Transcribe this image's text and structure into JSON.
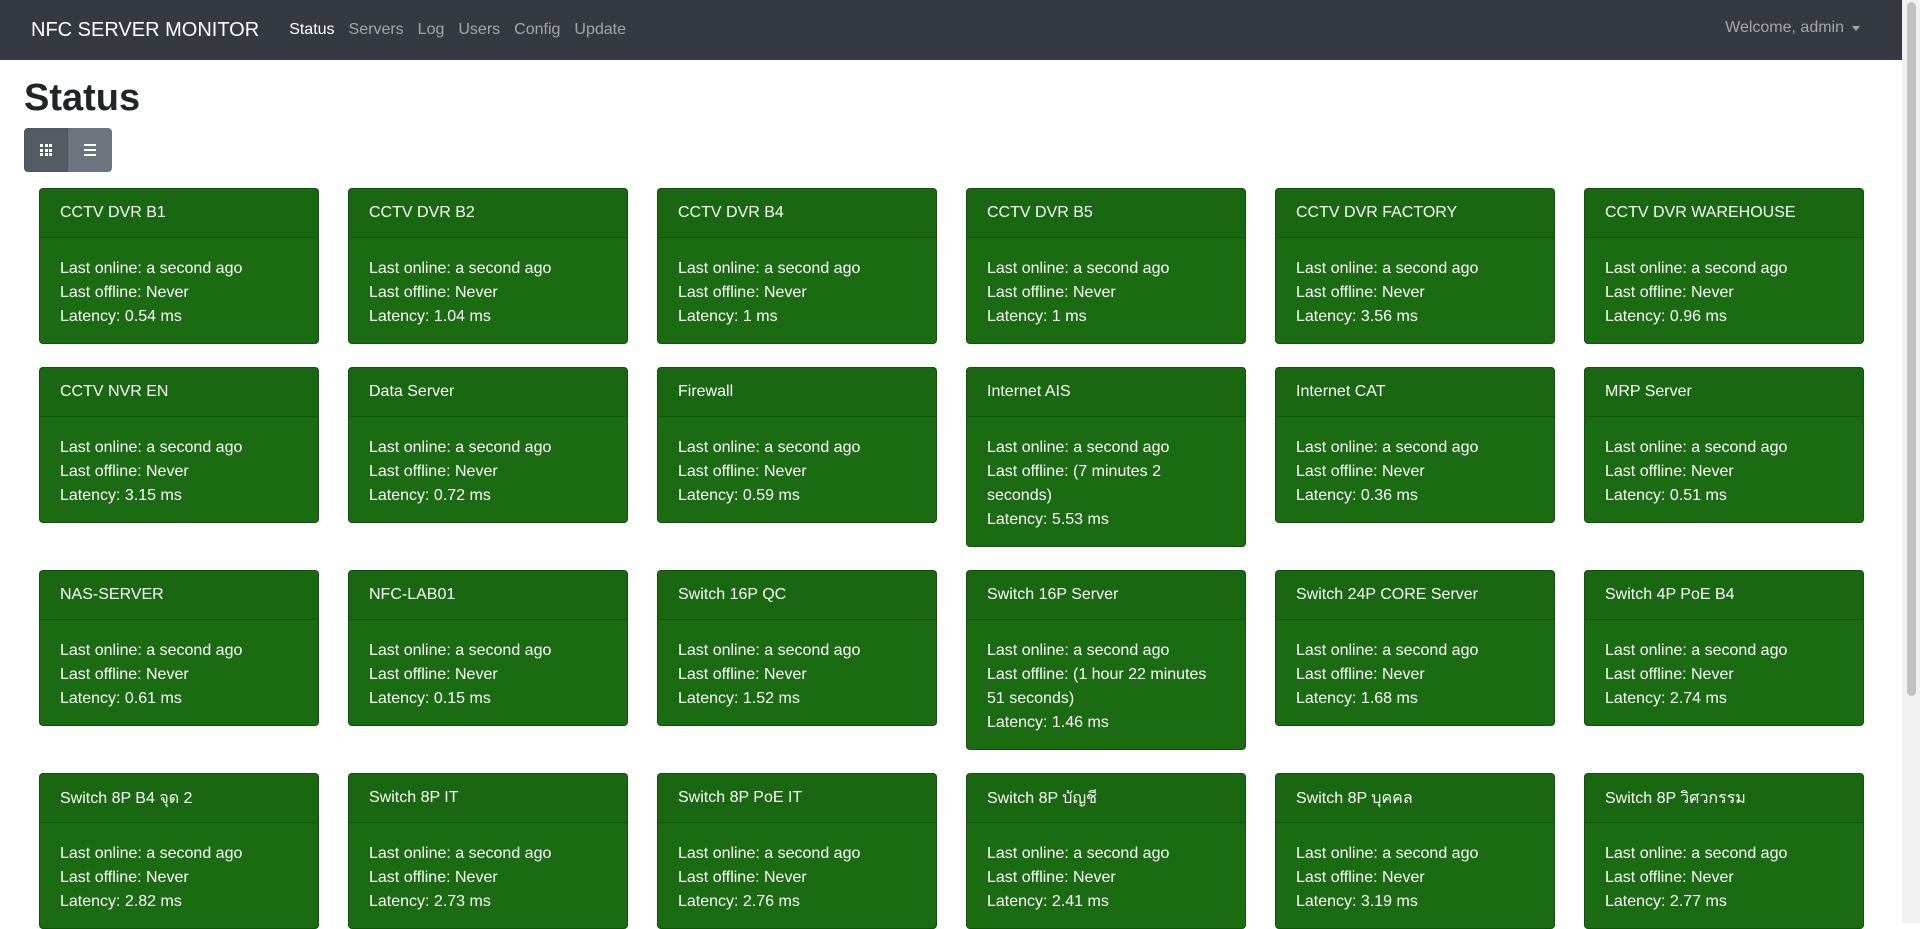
{
  "navbar": {
    "brand": "NFC SERVER MONITOR",
    "links": [
      "Status",
      "Servers",
      "Log",
      "Users",
      "Config",
      "Update"
    ],
    "user": "Welcome, admin"
  },
  "page": {
    "title": "Status"
  },
  "view_toggle": {
    "active": "grid"
  },
  "colors": {
    "online_card": "#1a6b12",
    "navbar": "#343a40"
  },
  "servers": [
    {
      "name": "CCTV DVR B1",
      "last_online": "Last online: a second ago",
      "last_offline": "Last offline: Never",
      "latency": "Latency: 0.54 ms"
    },
    {
      "name": "CCTV DVR B2",
      "last_online": "Last online: a second ago",
      "last_offline": "Last offline: Never",
      "latency": "Latency: 1.04 ms"
    },
    {
      "name": "CCTV DVR B4",
      "last_online": "Last online: a second ago",
      "last_offline": "Last offline: Never",
      "latency": "Latency: 1 ms"
    },
    {
      "name": "CCTV DVR B5",
      "last_online": "Last online: a second ago",
      "last_offline": "Last offline: Never",
      "latency": "Latency: 1 ms"
    },
    {
      "name": "CCTV DVR FACTORY",
      "last_online": "Last online: a second ago",
      "last_offline": "Last offline: Never",
      "latency": "Latency: 3.56 ms"
    },
    {
      "name": "CCTV DVR WAREHOUSE",
      "last_online": "Last online: a second ago",
      "last_offline": "Last offline: Never",
      "latency": "Latency: 0.96 ms"
    },
    {
      "name": "CCTV NVR EN",
      "last_online": "Last online: a second ago",
      "last_offline": "Last offline: Never",
      "latency": "Latency: 3.15 ms"
    },
    {
      "name": "Data Server",
      "last_online": "Last online: a second ago",
      "last_offline": "Last offline: Never",
      "latency": "Latency: 0.72 ms"
    },
    {
      "name": "Firewall",
      "last_online": "Last online: a second ago",
      "last_offline": "Last offline: Never",
      "latency": "Latency: 0.59 ms"
    },
    {
      "name": "Internet AIS",
      "last_online": "Last online: a second ago",
      "last_offline": "Last offline: (7 minutes 2 seconds)",
      "latency": "Latency: 5.53 ms"
    },
    {
      "name": "Internet CAT",
      "last_online": "Last online: a second ago",
      "last_offline": "Last offline: Never",
      "latency": "Latency: 0.36 ms"
    },
    {
      "name": "MRP Server",
      "last_online": "Last online: a second ago",
      "last_offline": "Last offline: Never",
      "latency": "Latency: 0.51 ms"
    },
    {
      "name": "NAS-SERVER",
      "last_online": "Last online: a second ago",
      "last_offline": "Last offline: Never",
      "latency": "Latency: 0.61 ms"
    },
    {
      "name": "NFC-LAB01",
      "last_online": "Last online: a second ago",
      "last_offline": "Last offline: Never",
      "latency": "Latency: 0.15 ms"
    },
    {
      "name": "Switch 16P QC",
      "last_online": "Last online: a second ago",
      "last_offline": "Last offline: Never",
      "latency": "Latency: 1.52 ms"
    },
    {
      "name": "Switch 16P Server",
      "last_online": "Last online: a second ago",
      "last_offline": "Last offline: (1 hour 22 minutes 51 seconds)",
      "latency": "Latency: 1.46 ms"
    },
    {
      "name": "Switch 24P CORE Server",
      "last_online": "Last online: a second ago",
      "last_offline": "Last offline: Never",
      "latency": "Latency: 1.68 ms"
    },
    {
      "name": "Switch 4P PoE B4",
      "last_online": "Last online: a second ago",
      "last_offline": "Last offline: Never",
      "latency": "Latency: 2.74 ms"
    },
    {
      "name": "Switch 8P B4 จุด 2",
      "last_online": "Last online: a second ago",
      "last_offline": "Last offline: Never",
      "latency": "Latency: 2.82 ms"
    },
    {
      "name": "Switch 8P IT",
      "last_online": "Last online: a second ago",
      "last_offline": "Last offline: Never",
      "latency": "Latency: 2.73 ms"
    },
    {
      "name": "Switch 8P PoE IT",
      "last_online": "Last online: a second ago",
      "last_offline": "Last offline: Never",
      "latency": "Latency: 2.76 ms"
    },
    {
      "name": "Switch 8P บัญชี",
      "last_online": "Last online: a second ago",
      "last_offline": "Last offline: Never",
      "latency": "Latency: 2.41 ms"
    },
    {
      "name": "Switch 8P บุคคล",
      "last_online": "Last online: a second ago",
      "last_offline": "Last offline: Never",
      "latency": "Latency: 3.19 ms"
    },
    {
      "name": "Switch 8P วิศวกรรม",
      "last_online": "Last online: a second ago",
      "last_offline": "Last offline: Never",
      "latency": "Latency: 2.77 ms"
    }
  ]
}
